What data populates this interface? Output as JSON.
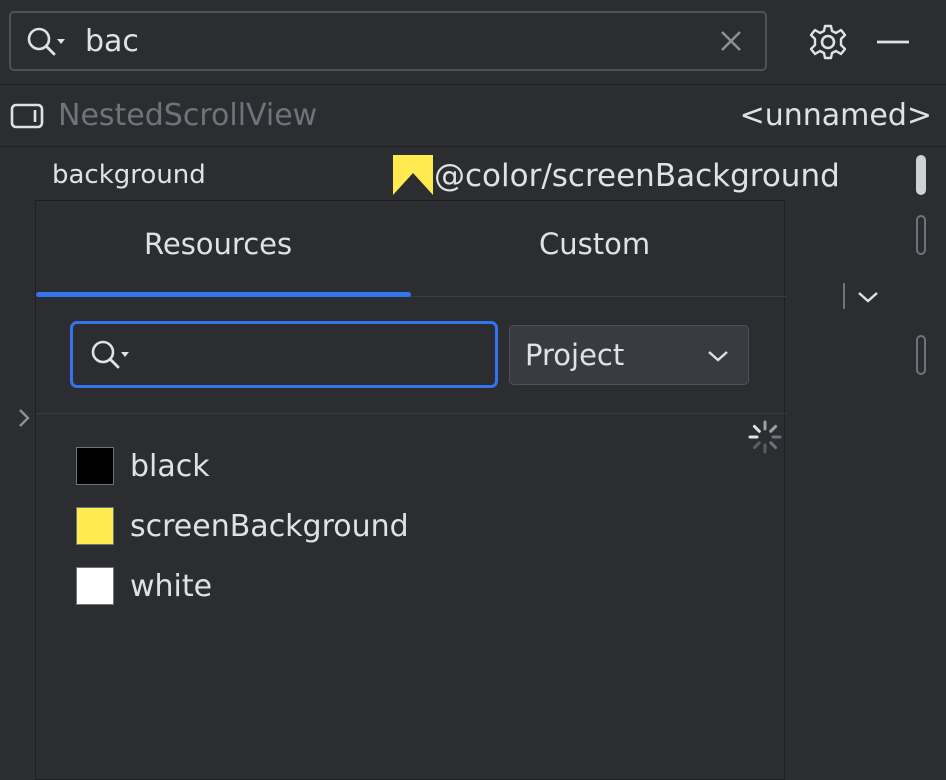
{
  "search": {
    "value": "bac"
  },
  "component": {
    "name": "NestedScrollView",
    "id": "<unnamed>"
  },
  "attribute": {
    "name": "background",
    "value": "@color/screenBackground",
    "swatch_color": "#ffeb4f"
  },
  "popup": {
    "tabs": [
      {
        "label": "Resources",
        "active": true
      },
      {
        "label": "Custom",
        "active": false
      }
    ],
    "search_value": "",
    "scope": "Project",
    "items": [
      {
        "label": "black",
        "color": "#000000"
      },
      {
        "label": "screenBackground",
        "color": "#ffeb4f"
      },
      {
        "label": "white",
        "color": "#ffffff"
      }
    ]
  },
  "colors": {
    "accent": "#3574f0",
    "background": "#2b2d30"
  },
  "icons": [
    "search-icon",
    "clear-icon",
    "gear-icon",
    "minimize-icon",
    "component-icon",
    "loading-spinner-icon",
    "chevron-down-icon",
    "chevron-right-icon"
  ]
}
